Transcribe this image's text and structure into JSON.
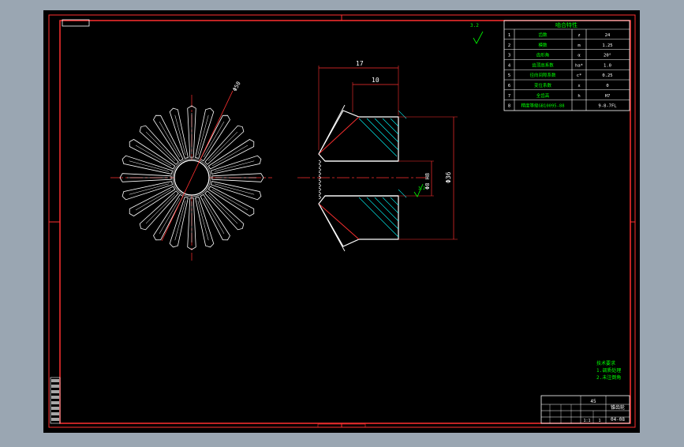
{
  "drawing": {
    "dimensions": {
      "overall_length": "17",
      "hub_length": "10",
      "bore_diameter": "Φ8 H8",
      "outer_diameter": "Φ36",
      "face_angle": "Φ50"
    },
    "surface_finish": "3.2",
    "param_table": {
      "header": "啮合特性",
      "rows": [
        {
          "no": "1",
          "name": "齿数",
          "sym": "z",
          "val": "24"
        },
        {
          "no": "2",
          "name": "模数",
          "sym": "m",
          "val": "1.25"
        },
        {
          "no": "3",
          "name": "齿形角",
          "sym": "α",
          "val": "20°"
        },
        {
          "no": "4",
          "name": "齿顶高系数",
          "sym": "ha*",
          "val": "1.0"
        },
        {
          "no": "5",
          "name": "径向间隙系数",
          "sym": "c*",
          "val": "0.25"
        },
        {
          "no": "6",
          "name": "变位系数",
          "sym": "x",
          "val": "0"
        },
        {
          "no": "7",
          "name": "全齿高",
          "sym": "h",
          "val": "H7"
        },
        {
          "no": "8",
          "name": "精度等级GB10095-88",
          "sym": "",
          "val": "9-8-7FL"
        }
      ]
    },
    "tech_notes": {
      "title": "技术要求",
      "lines": [
        "1.调质处理",
        "2.未注倒角"
      ]
    },
    "title_block": {
      "part_name": "锥齿轮",
      "material": "45",
      "scale": "1:1",
      "sheet": "1",
      "drawing_no": "04-08"
    }
  },
  "colors": {
    "background": "#000000",
    "frame": "#ff0000",
    "outline": "#ffffff",
    "dimension": "#ff0000",
    "annotation": "#00ff00",
    "hatch": "#00ffff"
  }
}
